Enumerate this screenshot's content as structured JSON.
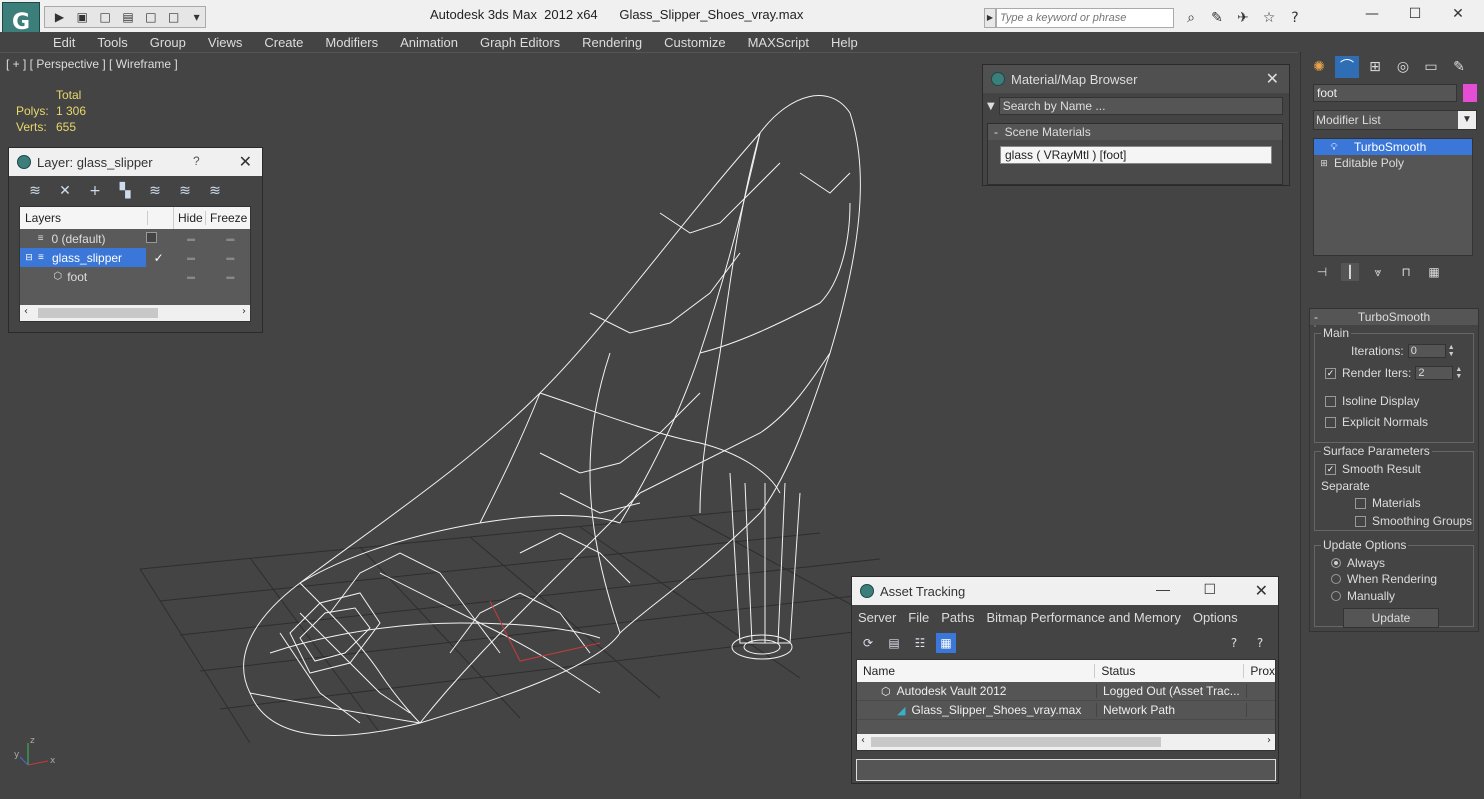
{
  "app": {
    "logo": "G",
    "title": "Autodesk 3ds Max  2012 x64      Glass_Slipper_Shoes_vray.max",
    "search_placeholder": "Type a keyword or phrase",
    "window_controls": [
      "—",
      "☐",
      "✕"
    ]
  },
  "quick_access": [
    "▶",
    "▣",
    "□",
    "▤",
    "□",
    "□",
    "▾"
  ],
  "menu": [
    "Edit",
    "Tools",
    "Group",
    "Views",
    "Create",
    "Modifiers",
    "Animation",
    "Graph Editors",
    "Rendering",
    "Customize",
    "MAXScript",
    "Help"
  ],
  "viewport": {
    "label": "[ + ] [ Perspective ] [ Wireframe ]",
    "stats": {
      "header": "Total",
      "polys_label": "Polys:",
      "polys": "1 306",
      "verts_label": "Verts:",
      "verts": "655"
    },
    "axis": {
      "x": "x",
      "y": "y",
      "z": "z"
    }
  },
  "layer_dialog": {
    "title": "Layer: glass_slipper",
    "help": "?",
    "close": "✕",
    "columns": [
      "Layers",
      "Hide",
      "Freeze"
    ],
    "rows": [
      {
        "name": "0 (default)"
      },
      {
        "name": "glass_slipper",
        "selected": true
      },
      {
        "name": "foot"
      }
    ]
  },
  "material_browser": {
    "title": "Material/Map Browser",
    "search": "Search by Name ...",
    "section": "Scene Materials",
    "section_toggle": "-",
    "item": "glass  ( VRayMtl )  [foot]"
  },
  "command_panel": {
    "object_name": "foot",
    "object_color": "#e54dd4",
    "modifier_list": "Modifier List",
    "stack": [
      "TurboSmooth",
      "Editable Poly"
    ],
    "rollout": {
      "title": "TurboSmooth",
      "toggle": "-",
      "main": "Main",
      "iterations_label": "Iterations:",
      "iterations": "0",
      "render_iters_label": "Render Iters:",
      "render_iters": "2",
      "isoline": "Isoline Display",
      "explicit_normals": "Explicit Normals",
      "surface_params": "Surface Parameters",
      "smooth_result": "Smooth Result",
      "separate": "Separate",
      "materials": "Materials",
      "smoothing_groups": "Smoothing Groups",
      "update_options": "Update Options",
      "always": "Always",
      "when_rendering": "When Rendering",
      "manually": "Manually",
      "update": "Update"
    }
  },
  "asset_tracking": {
    "title": "Asset Tracking",
    "menu": [
      "Server",
      "File",
      "Paths",
      "Bitmap Performance and Memory",
      "Options"
    ],
    "columns": [
      "Name",
      "Status",
      "Prox"
    ],
    "rows": [
      {
        "name": "Autodesk Vault 2012",
        "status": "Logged Out (Asset Trac..."
      },
      {
        "name": "Glass_Slipper_Shoes_vray.max",
        "status": "Network Path"
      }
    ]
  }
}
